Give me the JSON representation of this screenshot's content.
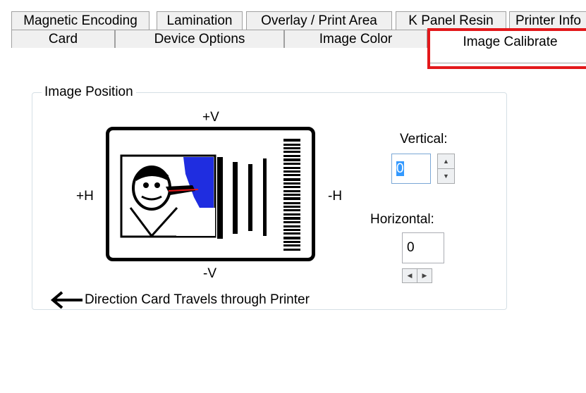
{
  "tabs": {
    "row1": [
      "Magnetic Encoding",
      "Lamination",
      "Overlay / Print Area",
      "K Panel Resin",
      "Printer Info"
    ],
    "row2": [
      "Card",
      "Device Options",
      "Image Color",
      "Image Calibrate"
    ],
    "active": "Image Calibrate"
  },
  "image_position": {
    "title": "Image Position",
    "plus_v": "+V",
    "minus_v": "-V",
    "plus_h": "+H",
    "minus_h": "-H",
    "direction_text": "Direction Card Travels through Printer",
    "arrow_icon": "left-arrow-icon"
  },
  "vertical": {
    "label": "Vertical:",
    "value": "0"
  },
  "horizontal": {
    "label": "Horizontal:",
    "value": "0"
  },
  "colors": {
    "highlight": "#e3181b",
    "selection": "#3399ff",
    "suit": "#1f2de0"
  }
}
